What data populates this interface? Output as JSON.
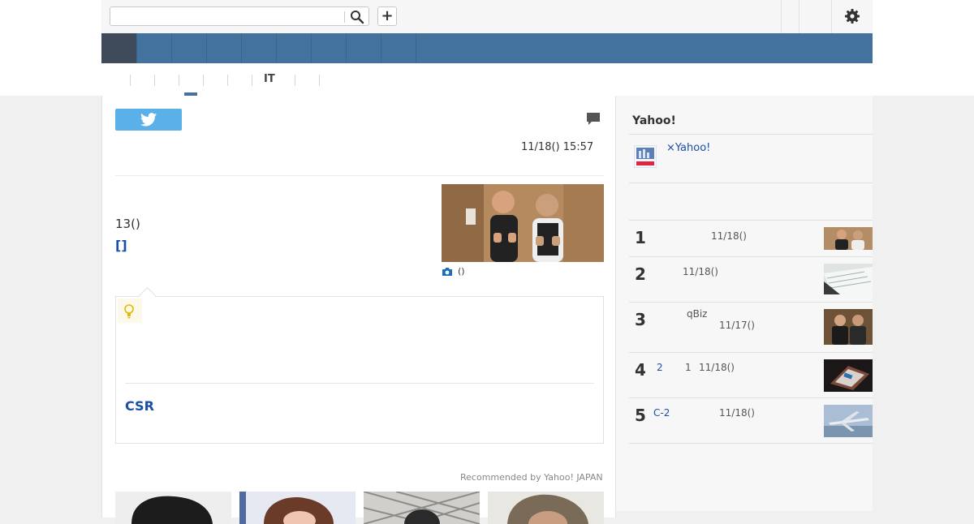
{
  "search": {
    "value": "",
    "placeholder": ""
  },
  "toolbar": {
    "add_label": "+"
  },
  "subnav": {
    "label_it": "IT"
  },
  "article": {
    "date": "11/18() 15:57",
    "paragraph": "13()",
    "link": "[]",
    "photo_caption": "()",
    "tip_link": "CSR",
    "recommended": "Recommended by Yahoo! JAPAN"
  },
  "sidebar": {
    "heading": "Yahoo!",
    "promo_link": "×Yahoo!",
    "ranking": [
      {
        "rank": "1",
        "title": "",
        "date": "11/18()"
      },
      {
        "rank": "2",
        "title": "",
        "date": "11/18()"
      },
      {
        "rank": "3",
        "title": "qBiz",
        "date": "11/17()"
      },
      {
        "rank": "4",
        "title_a": "2",
        "title_b": "1",
        "date": "11/18()"
      },
      {
        "rank": "5",
        "title": "C-2",
        "date": "11/18()"
      }
    ]
  },
  "colors": {
    "nav": "#43729f",
    "nav_active": "#3f4a5a",
    "link": "#1a4fa8",
    "twitter": "#5ab0e8"
  },
  "icons": [
    "search-icon",
    "plus-icon",
    "gear-icon",
    "twitter-icon",
    "comment-icon",
    "camera-icon",
    "lightbulb-icon"
  ]
}
